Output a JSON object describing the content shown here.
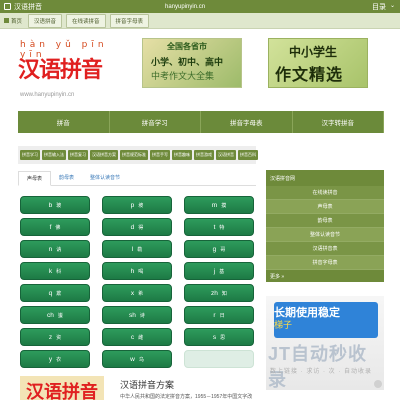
{
  "topbar": {
    "site_name": "汉语拼音",
    "domain": "hanyupinyin.cn",
    "menu_label": "目录",
    "menu_icon": "chevron-down-icon"
  },
  "subnav": {
    "home_label": "首页",
    "items": [
      "汉语拼音",
      "在线读拼音",
      "拼音字母表"
    ]
  },
  "logo": {
    "pinyin": "hàn yǔ pīn yīn",
    "hanzi": "汉语拼音",
    "url": "www.hanyupinyin.cn"
  },
  "banners": [
    {
      "line1": "全国各省市",
      "line2": "小学、初中、高中",
      "line3": "中考作文大全集"
    },
    {
      "line1": "中小学生",
      "line2": "作文精选"
    }
  ],
  "main_nav": [
    "拼音",
    "拼音学习",
    "拼音字母表",
    "汉字转拼音"
  ],
  "tags": [
    "拼音学习",
    "拼音输入法",
    "拼音复习",
    "汉语拼音方案",
    "拼音规范标准",
    "拼音手写",
    "拼音趣味",
    "拼音游戏",
    "汉语拼音",
    "拼音百科"
  ],
  "tabs": [
    "声母表",
    "韵母表",
    "整体认读音节"
  ],
  "letters": [
    {
      "l": "b",
      "s": "玻"
    },
    {
      "l": "p",
      "s": "坡"
    },
    {
      "l": "m",
      "s": "摸"
    },
    {
      "l": "f",
      "s": "佛"
    },
    {
      "l": "d",
      "s": "得"
    },
    {
      "l": "t",
      "s": "特"
    },
    {
      "l": "n",
      "s": "讷"
    },
    {
      "l": "l",
      "s": "勒"
    },
    {
      "l": "g",
      "s": "哥"
    },
    {
      "l": "k",
      "s": "科"
    },
    {
      "l": "h",
      "s": "喝"
    },
    {
      "l": "j",
      "s": "基"
    },
    {
      "l": "q",
      "s": "欺"
    },
    {
      "l": "x",
      "s": "希"
    },
    {
      "l": "zh",
      "s": "知"
    },
    {
      "l": "ch",
      "s": "蚩"
    },
    {
      "l": "sh",
      "s": "诗"
    },
    {
      "l": "r",
      "s": "日"
    },
    {
      "l": "z",
      "s": "资"
    },
    {
      "l": "c",
      "s": "雌"
    },
    {
      "l": "s",
      "s": "思"
    },
    {
      "l": "y",
      "s": "衣"
    },
    {
      "l": "w",
      "s": "乌"
    }
  ],
  "sidebar": {
    "items": [
      "汉语拼音网",
      "在线读拼音",
      "声母表",
      "韵母表",
      "整体认读音节",
      "汉语拼音表",
      "拼音字母表"
    ],
    "more": "更多 »"
  },
  "ad": {
    "line1": "长期使用稳定",
    "line2": "梯子",
    "brand": "JT自动秒收录",
    "slogan": "数上链接 · 求访 · 次 · 自动收录"
  },
  "article": {
    "thumb_text": "汉语拼音",
    "title": "汉语拼音方案",
    "excerpt": "中华人民共和国的法定拼音方案，1955－1957年中国文字改"
  }
}
